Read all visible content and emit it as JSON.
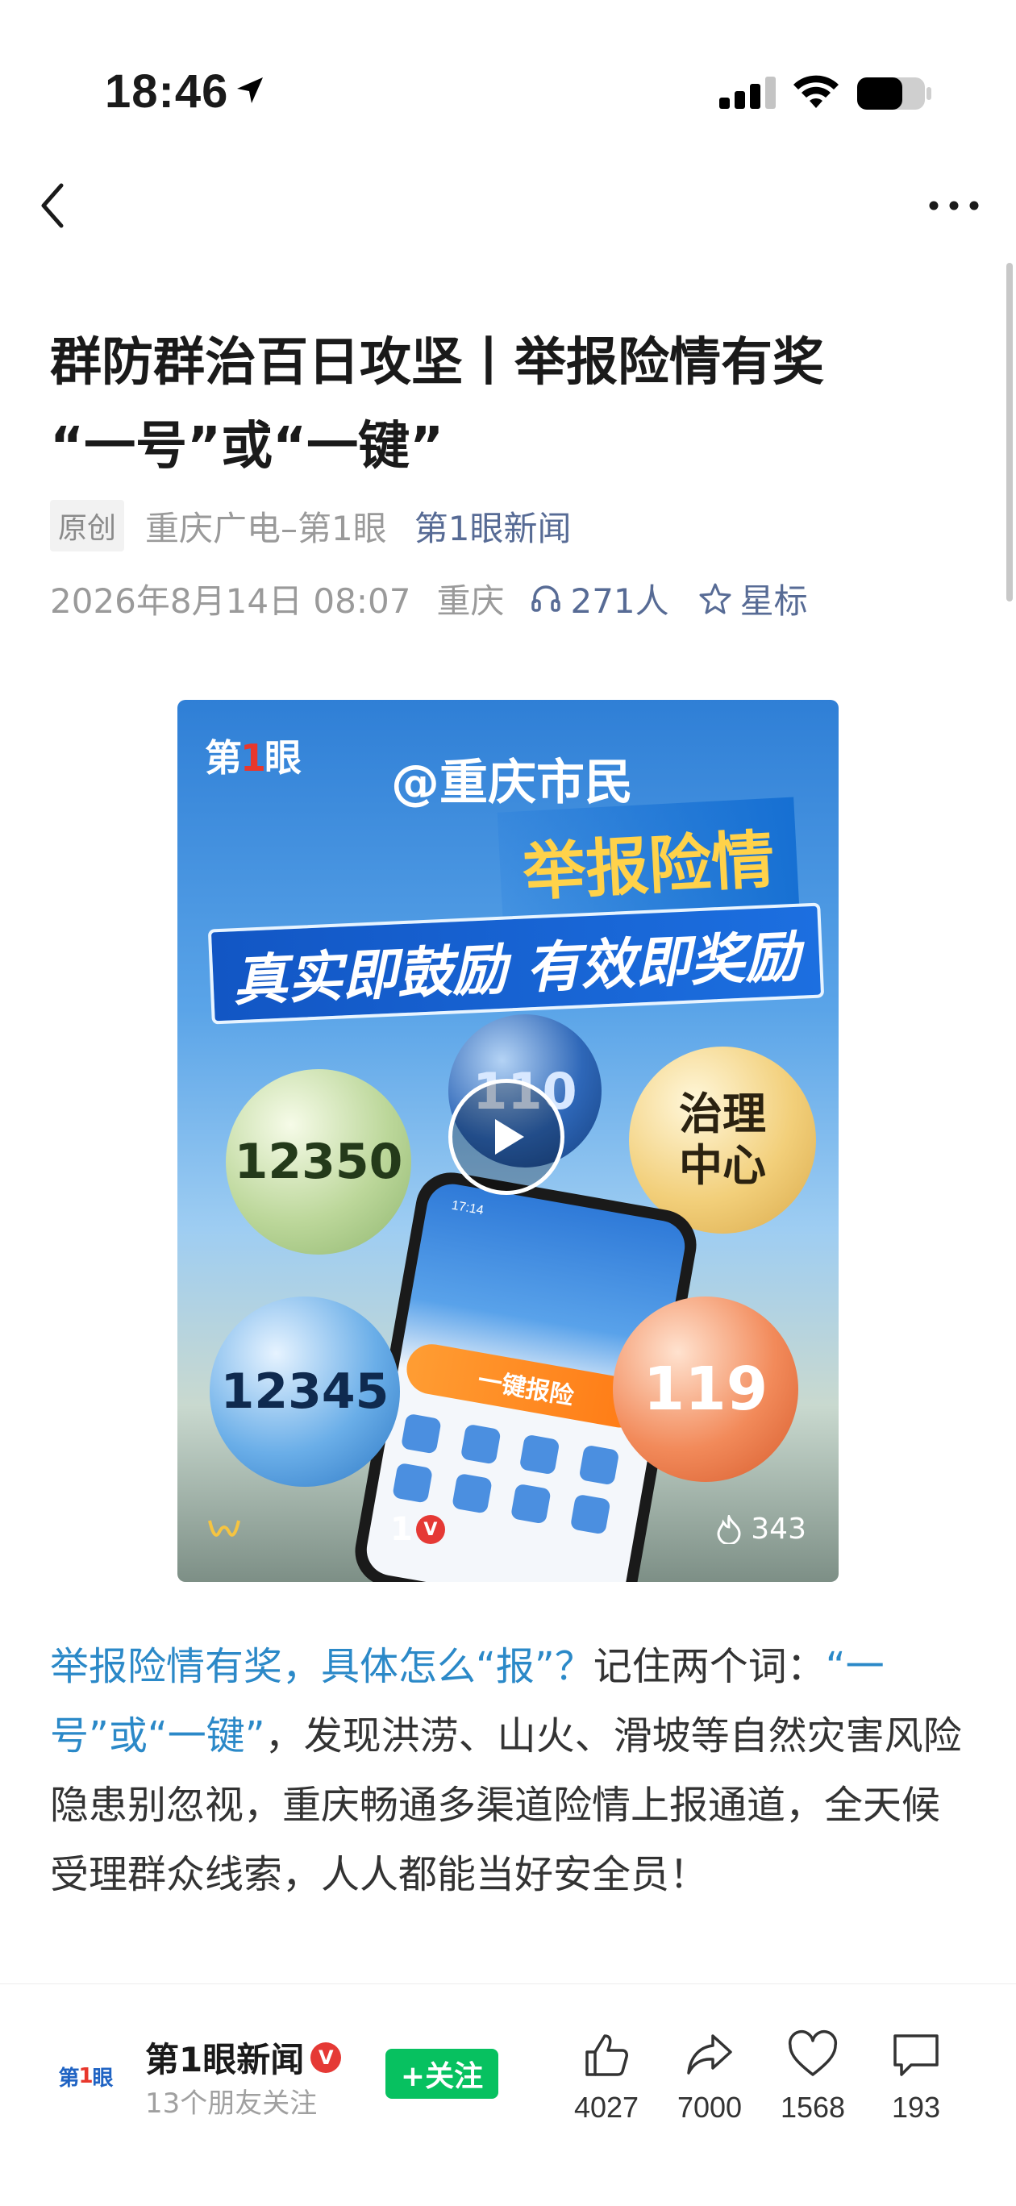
{
  "status_bar": {
    "time": "18:46"
  },
  "article": {
    "title_line1": "群防群治百日攻坚丨举报险情有奖",
    "title_line2": "“一号”或“一键”",
    "original_tag": "原创",
    "author": "重庆广电–第1眼",
    "channel": "第1眼新闻",
    "date": "2026年8月14日 08:07",
    "location": "重庆",
    "listeners": "271人",
    "star_label": "星标"
  },
  "video": {
    "logo_text": "第",
    "logo_one": "1",
    "logo_suffix": "眼",
    "at_text": "@重庆市民",
    "headline": "举报险情",
    "banner": "真实即鼓励 有效即奖励",
    "bubble_12350": "12350",
    "bubble_110": "110",
    "bubble_center": "治理\n中心",
    "bubble_12345": "12345",
    "bubble_119": "119",
    "phone_time": "17:14",
    "phone_button": "一键报险",
    "flag_number": "1",
    "heat_count": "343"
  },
  "body": {
    "highlight1": "举报险情有奖，具体怎么“报”？",
    "text1": "记住两个词：",
    "highlight2": "“一号”或“一键”",
    "text2": "，发现洪涝、山火、滑坡等自然灾害风险隐患别忽视，重庆畅通多渠道险情上报通道，全天候受理群众线索，人人都能当好安全员！"
  },
  "bottom_bar": {
    "account_logo_a": "第",
    "account_logo_one": "1",
    "account_logo_b": "眼",
    "account_name": "第1眼新闻",
    "followers_text": "13个朋友关注",
    "follow_label": "+关注",
    "likes": "4027",
    "shares": "7000",
    "favorites": "1568",
    "comments": "193"
  },
  "colors": {
    "link_blue": "#576b95",
    "highlight_blue": "#2b89c8",
    "follow_green": "#07c160",
    "verified_red": "#e53935"
  },
  "icons": [
    "location-arrow-icon",
    "signal-icon",
    "wifi-icon",
    "battery-icon",
    "back-icon",
    "more-icon",
    "headphones-icon",
    "star-icon",
    "play-icon",
    "flame-icon",
    "thumbs-up-icon",
    "share-icon",
    "heart-icon",
    "comment-icon"
  ]
}
